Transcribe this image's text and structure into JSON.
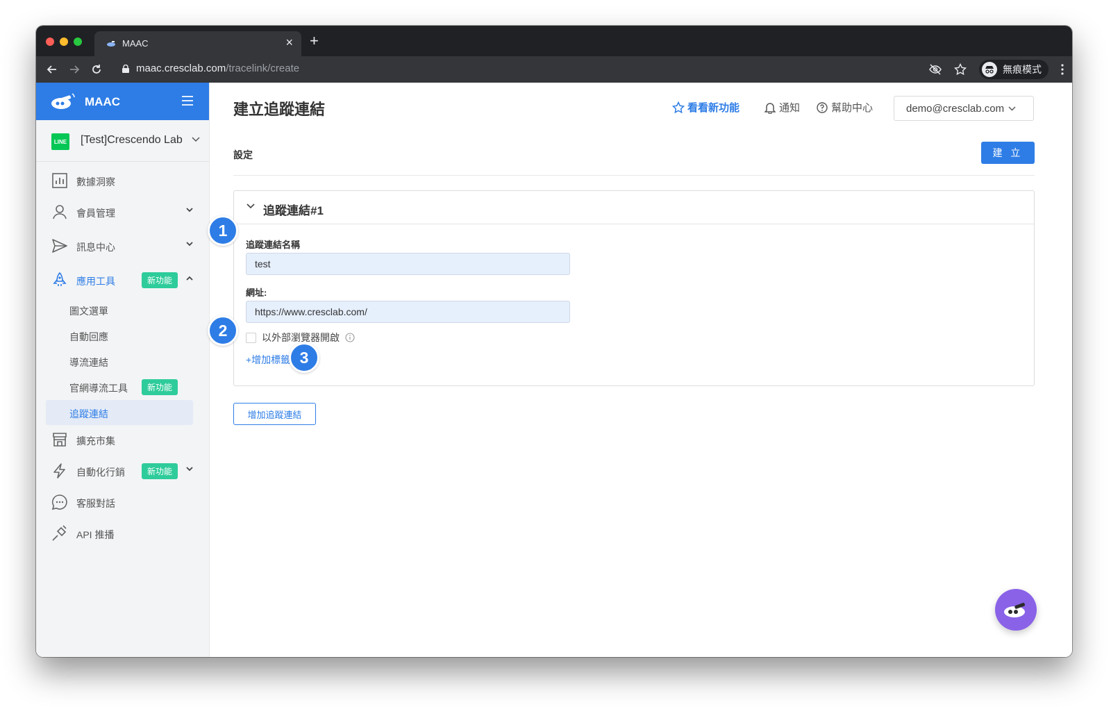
{
  "browser": {
    "tab_title": "MAAC",
    "url_host": "maac.cresclab.com",
    "url_path": "/tracelink/create",
    "incognito_label": "無痕模式",
    "new_tab_symbol": "+",
    "close_symbol": "×"
  },
  "sidebar": {
    "brand": "MAAC",
    "account_badge": "LINE",
    "account_name": "[Test]Crescendo Lab",
    "items": [
      {
        "label": "數據洞察",
        "icon": "chart-icon"
      },
      {
        "label": "會員管理",
        "icon": "user-icon"
      },
      {
        "label": "訊息中心",
        "icon": "send-icon"
      },
      {
        "label": "應用工具",
        "icon": "rocket-icon",
        "badge": "新功能"
      },
      {
        "label": "擴充市集",
        "icon": "store-icon"
      },
      {
        "label": "自動化行銷",
        "icon": "bolt-icon",
        "badge": "新功能"
      },
      {
        "label": "客服對話",
        "icon": "chat-icon"
      },
      {
        "label": "API 推播",
        "icon": "plug-icon"
      }
    ],
    "sub_items": [
      {
        "label": "圖文選單"
      },
      {
        "label": "自動回應"
      },
      {
        "label": "導流連結"
      },
      {
        "label": "官網導流工具",
        "badge": "新功能"
      },
      {
        "label": "追蹤連結"
      }
    ]
  },
  "header": {
    "title": "建立追蹤連結",
    "whats_new": "看看新功能",
    "notify": "通知",
    "help": "幫助中心",
    "user": "demo@cresclab.com"
  },
  "form": {
    "section_label": "設定",
    "create_button": "建 立",
    "card_title": "追蹤連結#1",
    "name_label": "追蹤連結名稱",
    "name_value": "test",
    "url_label": "網址:",
    "url_value": "https://www.cresclab.com/",
    "external_browser_label": "以外部瀏覽器開啟",
    "add_tag": "+增加標籤",
    "add_link_button": "增加追蹤連結"
  },
  "markers": [
    "1",
    "2",
    "3"
  ],
  "colors": {
    "brand_blue": "#2e7de6",
    "badge_green": "#2ecc9a",
    "line_green": "#06c755",
    "fab_purple": "#8a62e8"
  }
}
